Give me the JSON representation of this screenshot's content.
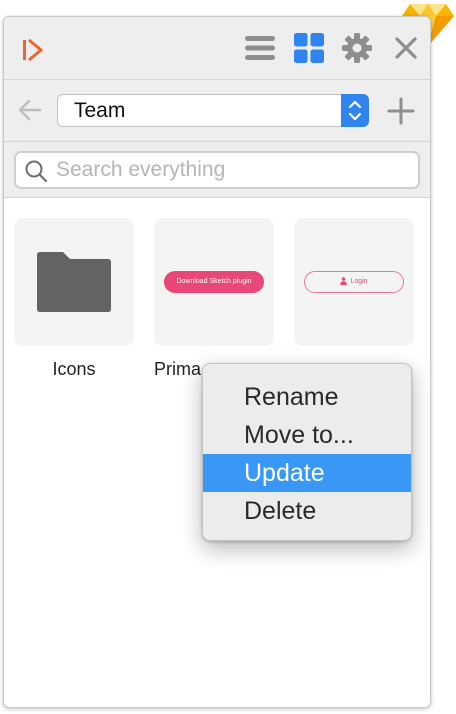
{
  "toolbar": {
    "logo_icon": "craft-logo-icon",
    "list_view_icon": "list-view-icon",
    "grid_view_icon": "grid-view-icon",
    "settings_icon": "gear-icon",
    "close_icon": "close-icon",
    "active_view": "grid",
    "accent_color": "#2f84ef"
  },
  "navigation": {
    "back_icon": "back-arrow-icon",
    "team_select_value": "Team",
    "add_icon": "plus-icon"
  },
  "search": {
    "placeholder": "Search everything",
    "value": ""
  },
  "items": [
    {
      "label": "Icons",
      "thumbnail": "folder-icon"
    },
    {
      "label": "Primary",
      "thumbnail_text": "Download Sketch plugin",
      "thumbnail_color": "#e84778"
    },
    {
      "label": "",
      "thumbnail_text": "Login",
      "thumbnail_color": "#e84778"
    }
  ],
  "context_menu": {
    "items": [
      {
        "label": "Rename"
      },
      {
        "label": "Move to..."
      },
      {
        "label": "Update",
        "highlighted": true
      },
      {
        "label": "Delete"
      }
    ],
    "highlight_color": "#3a97f5"
  },
  "badge": {
    "icon": "sketch-diamond-icon"
  }
}
